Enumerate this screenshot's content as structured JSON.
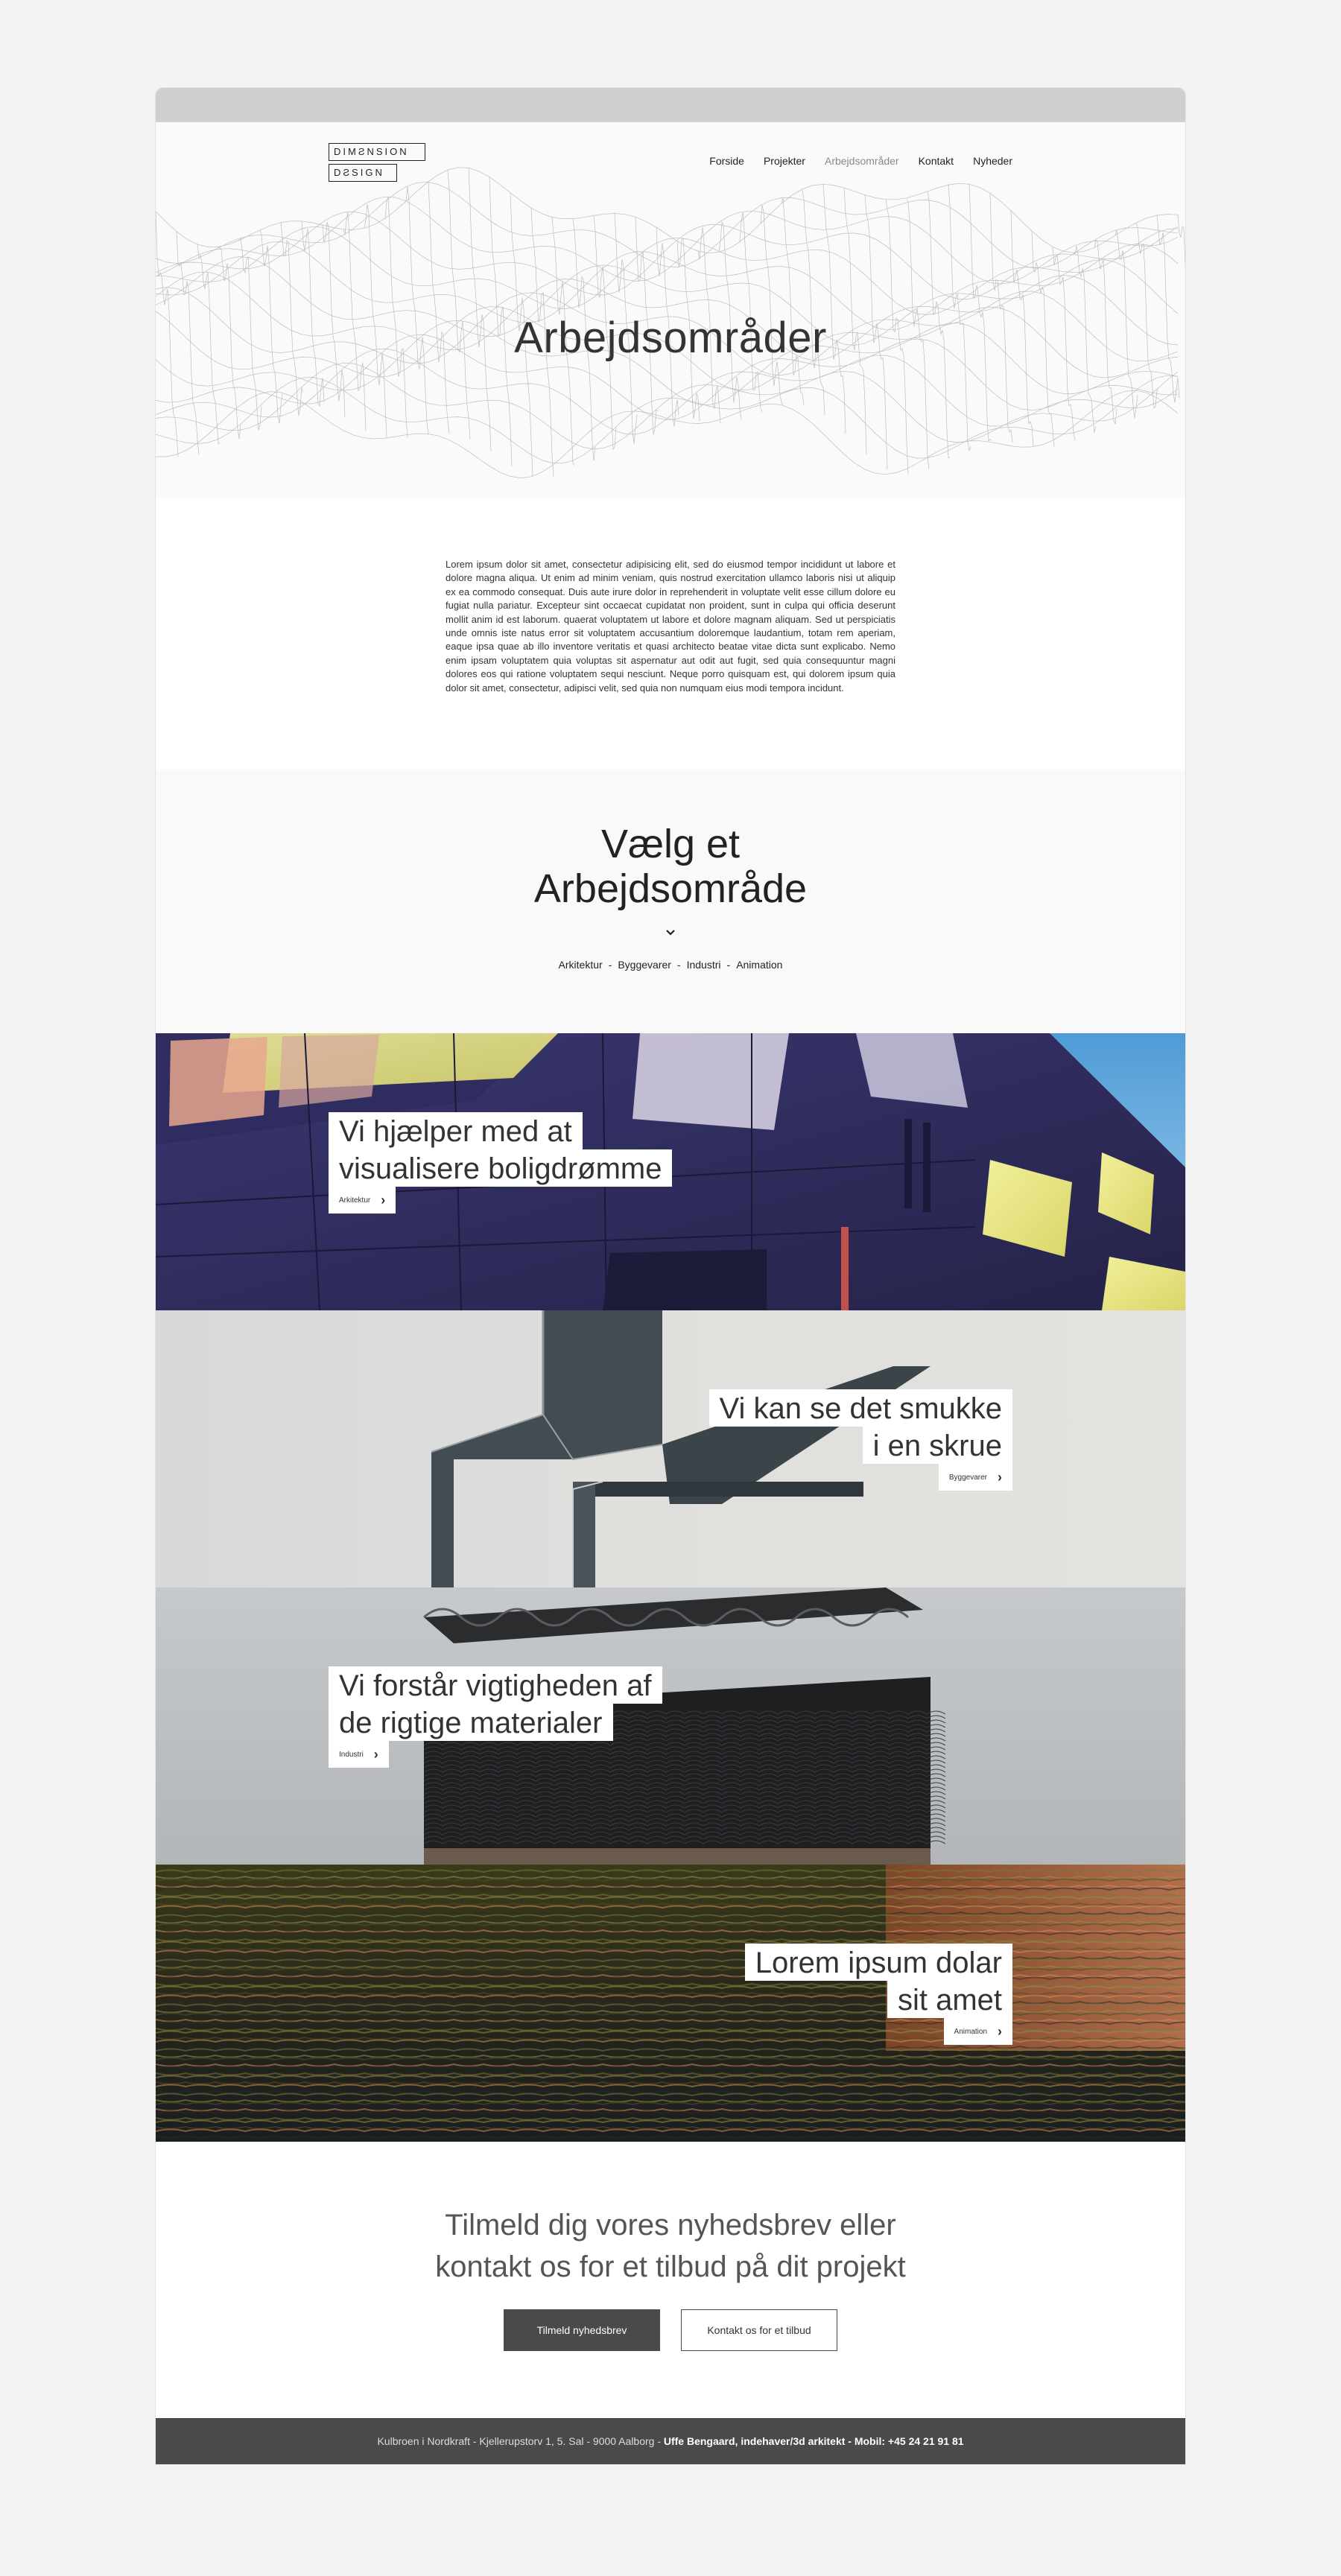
{
  "logo": {
    "line1": "DIMƧNSION",
    "line2": "DƧSIGN"
  },
  "nav": [
    {
      "label": "Forside",
      "active": false
    },
    {
      "label": "Projekter",
      "active": false
    },
    {
      "label": "Arbejdsområder",
      "active": true
    },
    {
      "label": "Kontakt",
      "active": false
    },
    {
      "label": "Nyheder",
      "active": false
    }
  ],
  "hero": {
    "title": "Arbejdsområder"
  },
  "intro": {
    "text": "Lorem ipsum dolor sit amet, consectetur adipisicing elit, sed do eiusmod tempor incididunt ut labore et dolore magna aliqua. Ut enim ad minim veniam, quis nostrud exercitation ullamco laboris nisi ut aliquip ex ea commodo consequat. Duis aute irure dolor in reprehenderit in voluptate velit esse cillum dolore eu fugiat nulla pariatur. Excepteur sint occaecat cupidatat non proident, sunt in culpa qui officia deserunt mollit anim id est laborum. quaerat voluptatem ut labore et dolore magnam aliquam. Sed ut perspiciatis unde omnis iste natus error sit voluptatem accusantium doloremque laudantium, totam rem aperiam, eaque ipsa quae ab illo inventore veritatis et quasi architecto beatae vitae dicta sunt explicabo. Nemo enim ipsam voluptatem quia voluptas sit aspernatur aut odit aut fugit, sed quia consequuntur magni dolores eos qui ratione voluptatem sequi nesciunt. Neque porro quisquam est, qui dolorem ipsum quia dolor sit amet, consectetur, adipisci velit, sed quia non numquam eius modi tempora incidunt."
  },
  "chooser": {
    "title_line1": "Vælg et",
    "title_line2": "Arbejdsområde",
    "categories": [
      "Arkitektur",
      "Byggevarer",
      "Industri",
      "Animation"
    ],
    "separator": "-"
  },
  "panels": [
    {
      "line1": "Vi hjælper med at",
      "line2": "visualisere boligdrømme",
      "button": "Arkitektur",
      "align": "left"
    },
    {
      "line1": "Vi kan se det smukke",
      "line2": "i en skrue",
      "button": "Byggevarer",
      "align": "right"
    },
    {
      "line1": "Vi forstår vigtigheden af",
      "line2": "de rigtige materialer",
      "button": "Industri",
      "align": "left"
    },
    {
      "line1": "Lorem ipsum dolar",
      "line2": "sit amet",
      "button": "Animation",
      "align": "right"
    }
  ],
  "newsletter": {
    "line1": "Tilmeld dig vores nyhedsbrev eller",
    "line2": "kontakt os for et tilbud på dit projekt",
    "subscribe_button": "Tilmeld nyhedsbrev",
    "contact_button": "Kontakt os for et tilbud"
  },
  "footer": {
    "address": "Kulbroen i Nordkraft - Kjellerupstorv 1, 5. Sal - 9000 Aalborg - ",
    "contact": "Uffe Bengaard, indehaver/3d arkitekt - Mobil: +45 24 21 91 81"
  },
  "colors": {
    "dark": "#4a4a4a",
    "page_bg": "#f3f3f3",
    "band_bg": "#f9f9f9"
  }
}
